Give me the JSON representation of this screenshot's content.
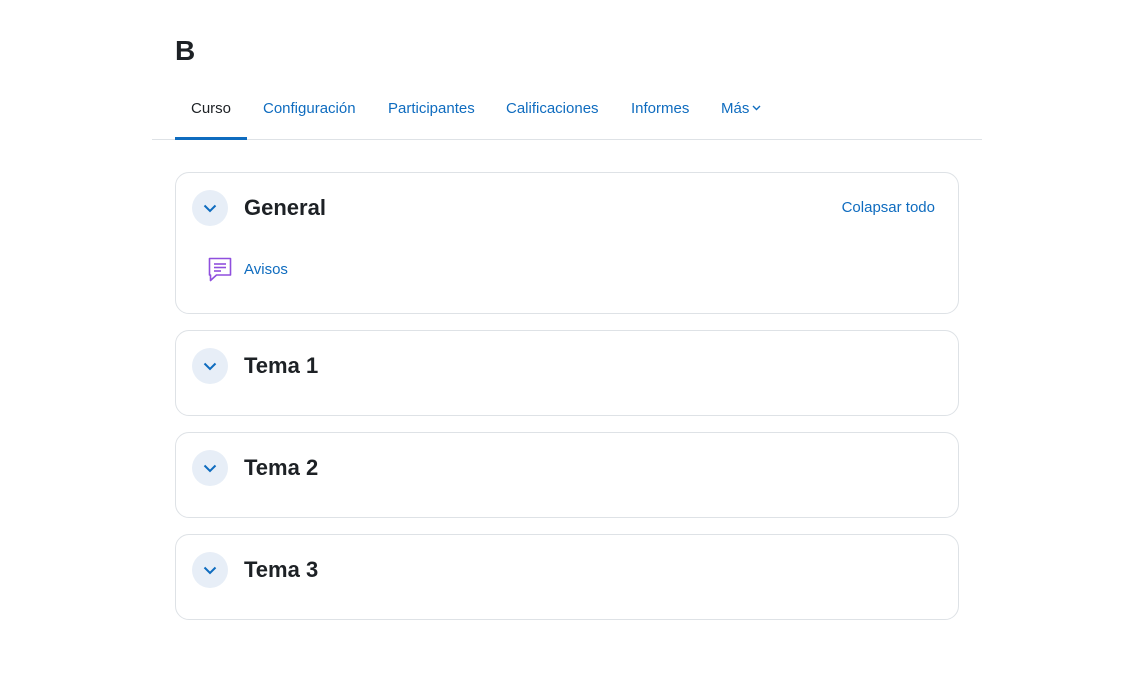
{
  "course": {
    "title": "B"
  },
  "nav": {
    "tabs": [
      {
        "label": "Curso",
        "active": true
      },
      {
        "label": "Configuración",
        "active": false
      },
      {
        "label": "Participantes",
        "active": false
      },
      {
        "label": "Calificaciones",
        "active": false
      },
      {
        "label": "Informes",
        "active": false
      },
      {
        "label": "Más",
        "active": false,
        "icon": "chevron-down-icon"
      }
    ]
  },
  "sections": [
    {
      "title": "General",
      "collapse_all_label": "Colapsar todo",
      "activities": [
        {
          "label": "Avisos",
          "icon": "forum-icon",
          "icon_color": "#8f4fde"
        }
      ]
    },
    {
      "title": "Tema 1"
    },
    {
      "title": "Tema 2"
    },
    {
      "title": "Tema 3"
    }
  ],
  "colors": {
    "link": "#0f6cbf",
    "text": "#1d2125",
    "toggle_bg": "#e7eef7",
    "border": "#dee2e6"
  }
}
